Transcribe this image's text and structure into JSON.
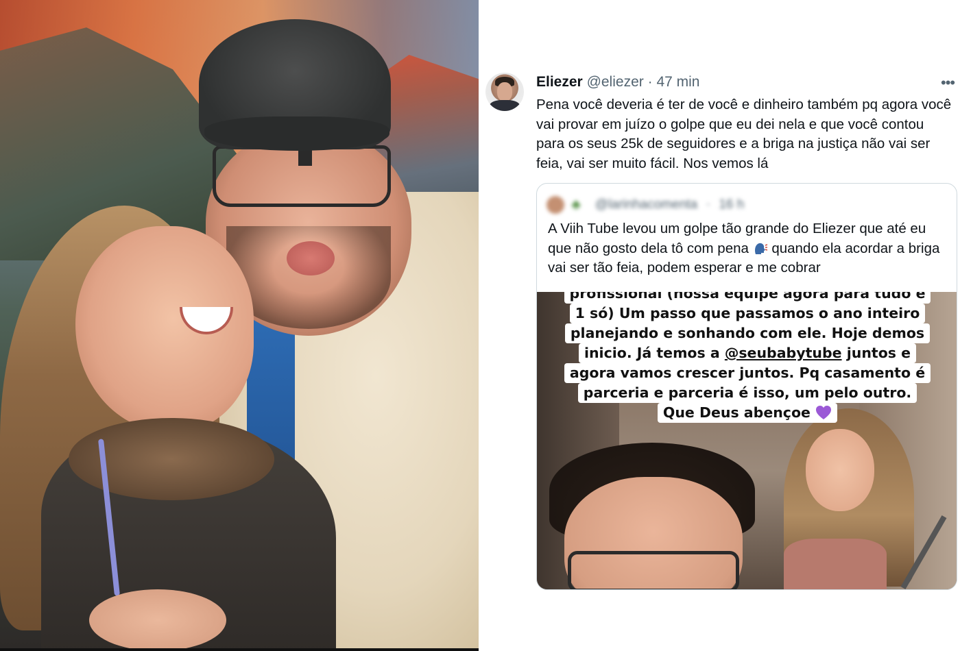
{
  "tweet": {
    "author_name": "Eliezer",
    "author_handle": "@eliezer",
    "separator": "·",
    "time": "47 min",
    "more_icon": "more-horizontal-icon",
    "text": "Pena você deveria é ter de você e dinheiro também pq agora você vai provar em juízo o golpe que eu dei nela e que você contou para os seus 25k de seguidores e a briga na justiça não vai ser feia, vai ser muito fácil. Nos vemos lá"
  },
  "quote": {
    "handle": "@larinhacomenta",
    "separator": "·",
    "time": "16 h",
    "text_before_emoji": "A Viih Tube levou um golpe tão grande do Eliezer que até eu que não gosto dela tô com pena",
    "emoji": "speaking-head-icon",
    "text_after_emoji": "quando ela acordar a briga vai ser tão feia, podem esperar e me cobrar",
    "story": {
      "line_0": "profissional (nossa equipe agora para tudo é",
      "line_1": "1 só) Um passo que passamos o ano inteiro",
      "line_2": "planejando e sonhando com ele. Hoje demos",
      "line_3_before": "inicio. Já temos a",
      "line_3_mention": "@seubabytube",
      "line_3_after": "juntos e",
      "line_4": "agora vamos crescer juntos. Pq casamento é",
      "line_5": "parceria e parceria é isso, um pelo outro.",
      "line_6": "Que Deus abençoe",
      "heart": "purple-heart-icon"
    }
  },
  "colors": {
    "text_primary": "#0f1419",
    "text_secondary": "#536471",
    "border": "#cfd9de",
    "heart": "#9b59d6"
  }
}
